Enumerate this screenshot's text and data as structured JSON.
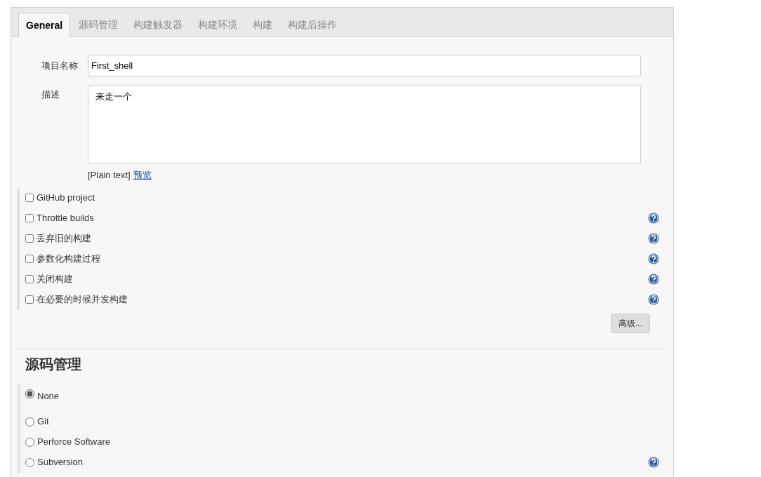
{
  "tabs": [
    {
      "label": "General",
      "selected": true
    },
    {
      "label": "源码管理",
      "selected": false
    },
    {
      "label": "构建触发器",
      "selected": false
    },
    {
      "label": "构建环境",
      "selected": false
    },
    {
      "label": "构建",
      "selected": false
    },
    {
      "label": "构建后操作",
      "selected": false
    }
  ],
  "project_name": {
    "label": "项目名称",
    "value": "First_shell"
  },
  "description": {
    "label": "描述",
    "value": "来走一个",
    "format": "[Plain text]",
    "preview_link": "预览"
  },
  "options": [
    {
      "label": "GitHub project",
      "checked": false,
      "help": false
    },
    {
      "label": "Throttle builds",
      "checked": false,
      "help": true
    },
    {
      "label": "丢弃旧的构建",
      "checked": false,
      "help": true
    },
    {
      "label": "参数化构建过程",
      "checked": false,
      "help": true
    },
    {
      "label": "关闭构建",
      "checked": false,
      "help": true
    },
    {
      "label": "在必要的时候并发构建",
      "checked": false,
      "help": true
    }
  ],
  "advanced_button": "高级...",
  "scm": {
    "heading": "源码管理",
    "options": [
      {
        "label": "None",
        "selected": true,
        "help": false
      },
      {
        "label": "Git",
        "selected": false,
        "help": false
      },
      {
        "label": "Perforce Software",
        "selected": false,
        "help": false
      },
      {
        "label": "Subversion",
        "selected": false,
        "help": true
      }
    ]
  }
}
